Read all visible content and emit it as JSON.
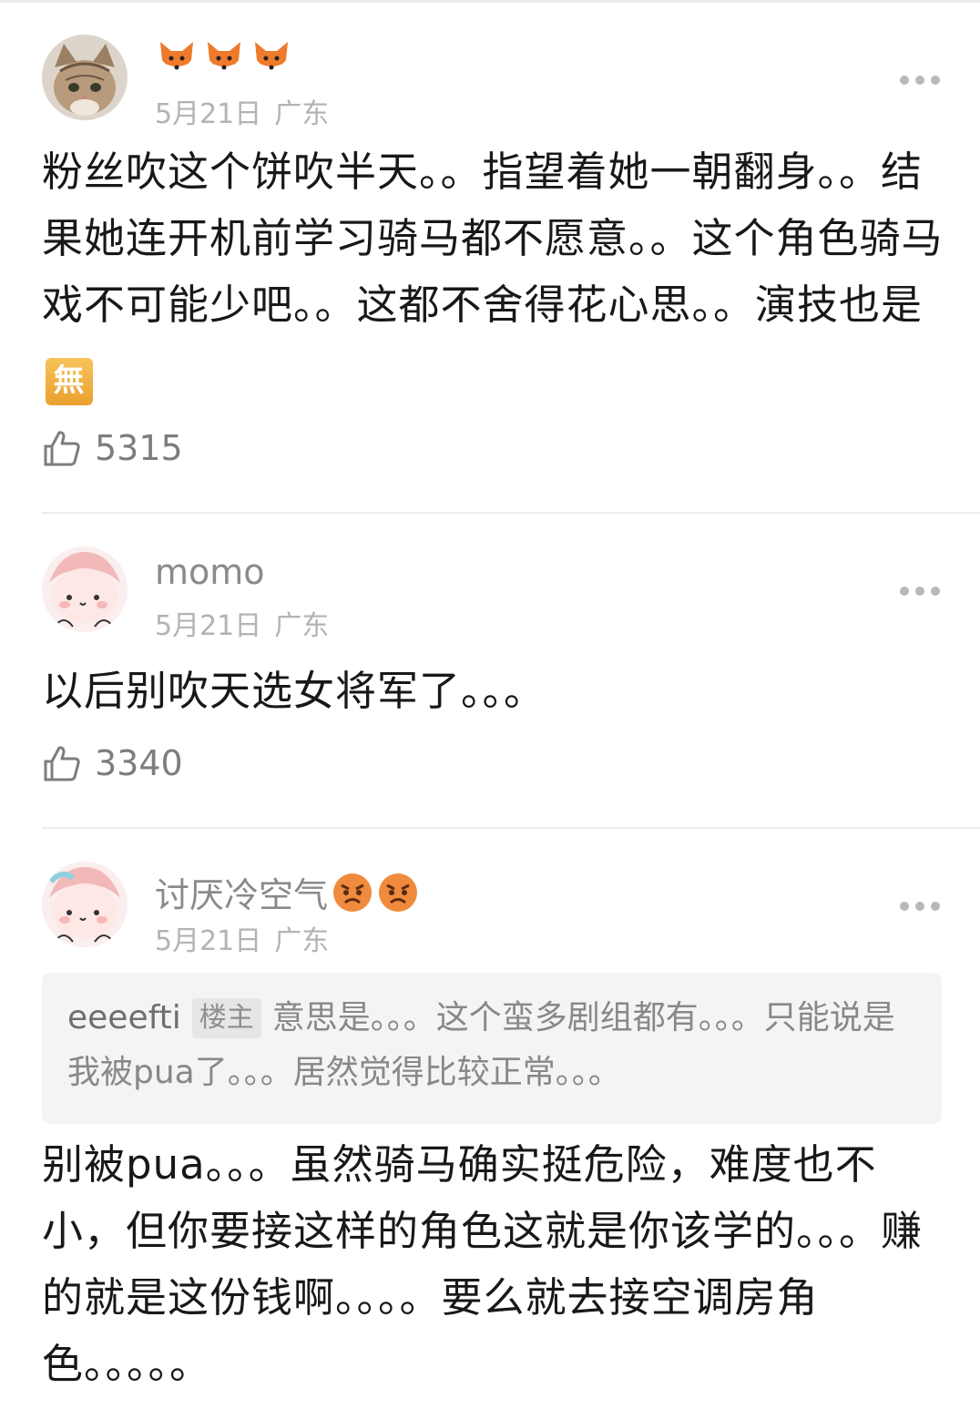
{
  "comments": [
    {
      "username": "",
      "name_emojis": [
        "fox-emoji",
        "fox-emoji",
        "fox-emoji"
      ],
      "date": "5月21日",
      "location": "广东",
      "text": "粉丝吹这个饼吹半天。。指望着她一朝翻身。。结果她连开机前学习骑马都不愿意。。这个角色骑马戏不可能少吧。。这都不舍得花心思。。演技也是",
      "trailing_badge": "無",
      "likes": "5315"
    },
    {
      "username": "momo",
      "date": "5月21日",
      "location": "广东",
      "text": "以后别吹天选女将军了。。。",
      "likes": "3340"
    },
    {
      "username": "讨厌冷空气",
      "name_emojis": [
        "angry-emoji",
        "angry-emoji"
      ],
      "date": "5月21日",
      "location": "广东",
      "quote": {
        "name": "eeeefti",
        "tag": "楼主",
        "text": "意思是。。。这个蛮多剧组都有。。。只能说是我被pua了。。。居然觉得比较正常。。。"
      },
      "text": "别被pua。。。虽然骑马确实挺危险，难度也不小，但你要接这样的角色这就是你该学的。。。赚的就是这份钱啊。。。。要么就去接空调房角色。。。。。"
    }
  ],
  "colors": {
    "meta_gray": "#b3b3b3",
    "username_gray": "#8a8a8a",
    "quote_bg": "#f4f4f4",
    "divider": "#ececec"
  }
}
